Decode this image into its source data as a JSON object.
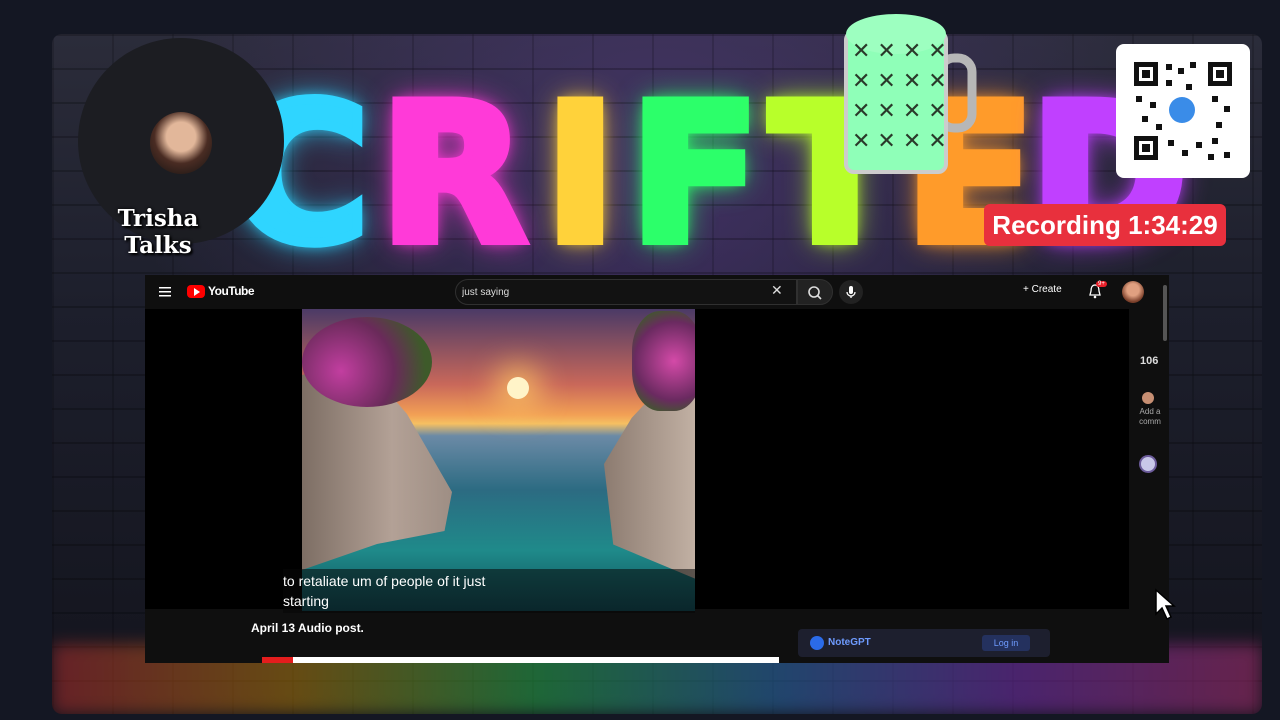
{
  "overlay": {
    "host_name": "Trisha Talks",
    "recording_label": "Recording 1:34:29",
    "neon_letters": [
      "C",
      "R",
      "I",
      "F",
      "T",
      "E",
      "D"
    ],
    "neon_colors": [
      "#2fd5ff",
      "#ff3ad8",
      "#ffd23a",
      "#2cff6a",
      "#b8ff2a",
      "#ff9b2a",
      "#c040ff"
    ],
    "accent_red": "#e8303d"
  },
  "browser": {
    "logo_text": "YouTube",
    "search_value": "just saying",
    "create_label": "+ Create",
    "notification_count": "9+",
    "video_title": "April 13 Audio post.",
    "caption": "to retaliate um of people of it just\nstarting",
    "progress_fraction": 0.06,
    "side_count": "106",
    "side_add_comment": "Add a comm",
    "notegpt_label": "NoteGPT",
    "notegpt_login": "Log in"
  },
  "icons": [
    "menu-icon",
    "youtube-logo-icon",
    "clear-icon",
    "search-icon",
    "mic-icon",
    "bell-icon",
    "mouse-cursor-icon",
    "qr-code",
    "beer-mug"
  ]
}
